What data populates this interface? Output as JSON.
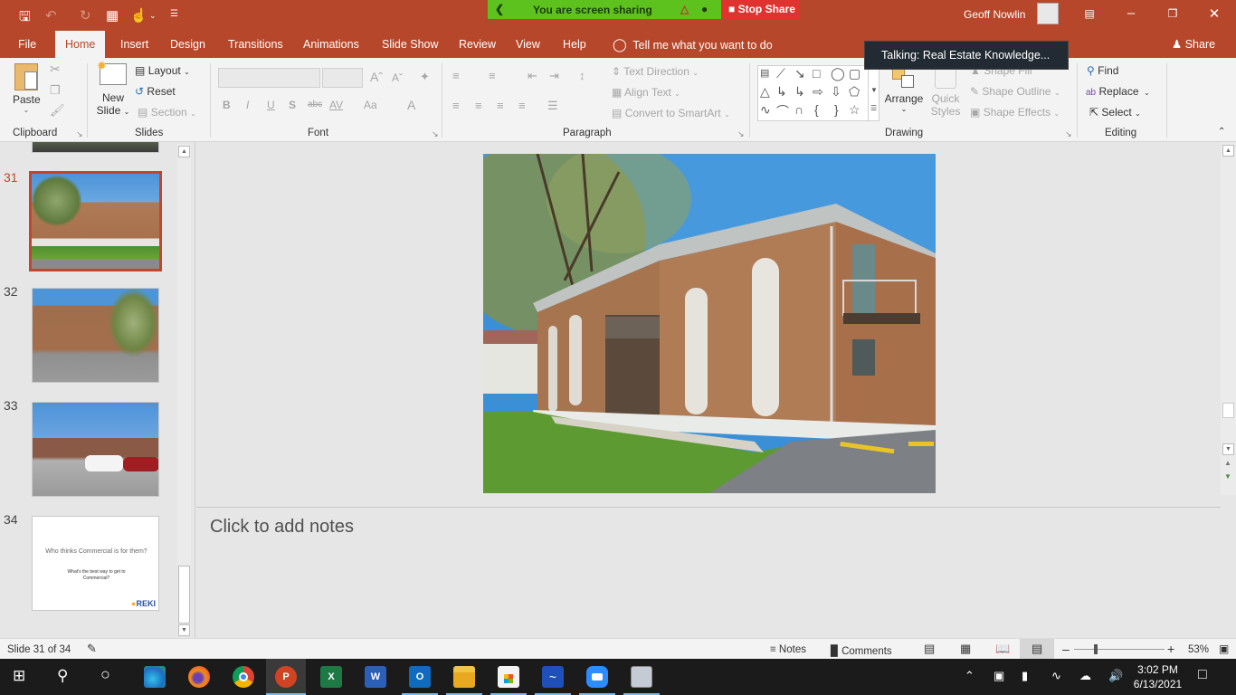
{
  "titlebar": {
    "quick_access": [
      "save-icon",
      "undo-icon",
      "redo-icon",
      "present-from-beginning-icon",
      "touch-mode-icon",
      "customize-icon"
    ],
    "screen_share": {
      "status_text": "You are screen sharing",
      "stop_label": "Stop Share"
    },
    "user_name": "Geoff Nowlin",
    "window_controls": [
      "ribbon-display-options-icon",
      "minimize-icon",
      "restore-icon",
      "close-icon"
    ]
  },
  "menu": {
    "tabs": [
      {
        "label": "File"
      },
      {
        "label": "Home",
        "active": true
      },
      {
        "label": "Insert"
      },
      {
        "label": "Design"
      },
      {
        "label": "Transitions"
      },
      {
        "label": "Animations"
      },
      {
        "label": "Slide Show"
      },
      {
        "label": "Review"
      },
      {
        "label": "View"
      },
      {
        "label": "Help"
      }
    ],
    "tell_me": "Tell me what you want to do",
    "share": "Share"
  },
  "tooltip": "Talking: Real Estate Knowledge...",
  "ribbon": {
    "clipboard": {
      "label": "Clipboard",
      "paste": "Paste"
    },
    "slides": {
      "label": "Slides",
      "new_slide_line1": "New",
      "new_slide_line2": "Slide",
      "layout": "Layout",
      "reset": "Reset",
      "section": "Section"
    },
    "font": {
      "label": "Font",
      "buttons": [
        "B",
        "I",
        "U",
        "S",
        "abc",
        "AV",
        "Aa",
        "A"
      ]
    },
    "paragraph": {
      "label": "Paragraph",
      "text_direction": "Text Direction",
      "align_text": "Align Text",
      "convert_smartart": "Convert to SmartArt"
    },
    "drawing": {
      "label": "Drawing",
      "arrange": "Arrange",
      "quick_styles_1": "Quick",
      "quick_styles_2": "Styles",
      "shape_fill": "Shape Fill",
      "shape_outline": "Shape Outline",
      "shape_effects": "Shape Effects"
    },
    "editing": {
      "label": "Editing",
      "find": "Find",
      "replace": "Replace",
      "select": "Select"
    }
  },
  "slides_panel": {
    "items": [
      {
        "number": "31",
        "selected": true,
        "kind": "photo-building-front"
      },
      {
        "number": "32",
        "selected": false,
        "kind": "photo-building-side"
      },
      {
        "number": "33",
        "selected": false,
        "kind": "photo-parking-lot"
      },
      {
        "number": "34",
        "selected": false,
        "kind": "text-slide",
        "title": "Who thinks Commercial is for them?",
        "subtitle": "What's the best way to get to Commercial?",
        "logo": "REKI"
      }
    ]
  },
  "notes": {
    "placeholder": "Click to add notes"
  },
  "status": {
    "slide_indicator": "Slide 31 of 34",
    "notes_label": "Notes",
    "comments_label": "Comments",
    "zoom_percent": "53%",
    "zoom_fraction": 0.53
  },
  "taskbar": {
    "apps": [
      "start",
      "search",
      "cortana",
      "edge",
      "firefox",
      "chrome",
      "powerpoint",
      "excel",
      "word",
      "outlook",
      "file-explorer",
      "store",
      "whiteboard",
      "zoom",
      "media-app"
    ],
    "time": "3:02 PM",
    "date": "6/13/2021"
  },
  "colors": {
    "accent": "#b7472a",
    "share_green": "#5dc21e",
    "stop_red": "#e0322e"
  }
}
